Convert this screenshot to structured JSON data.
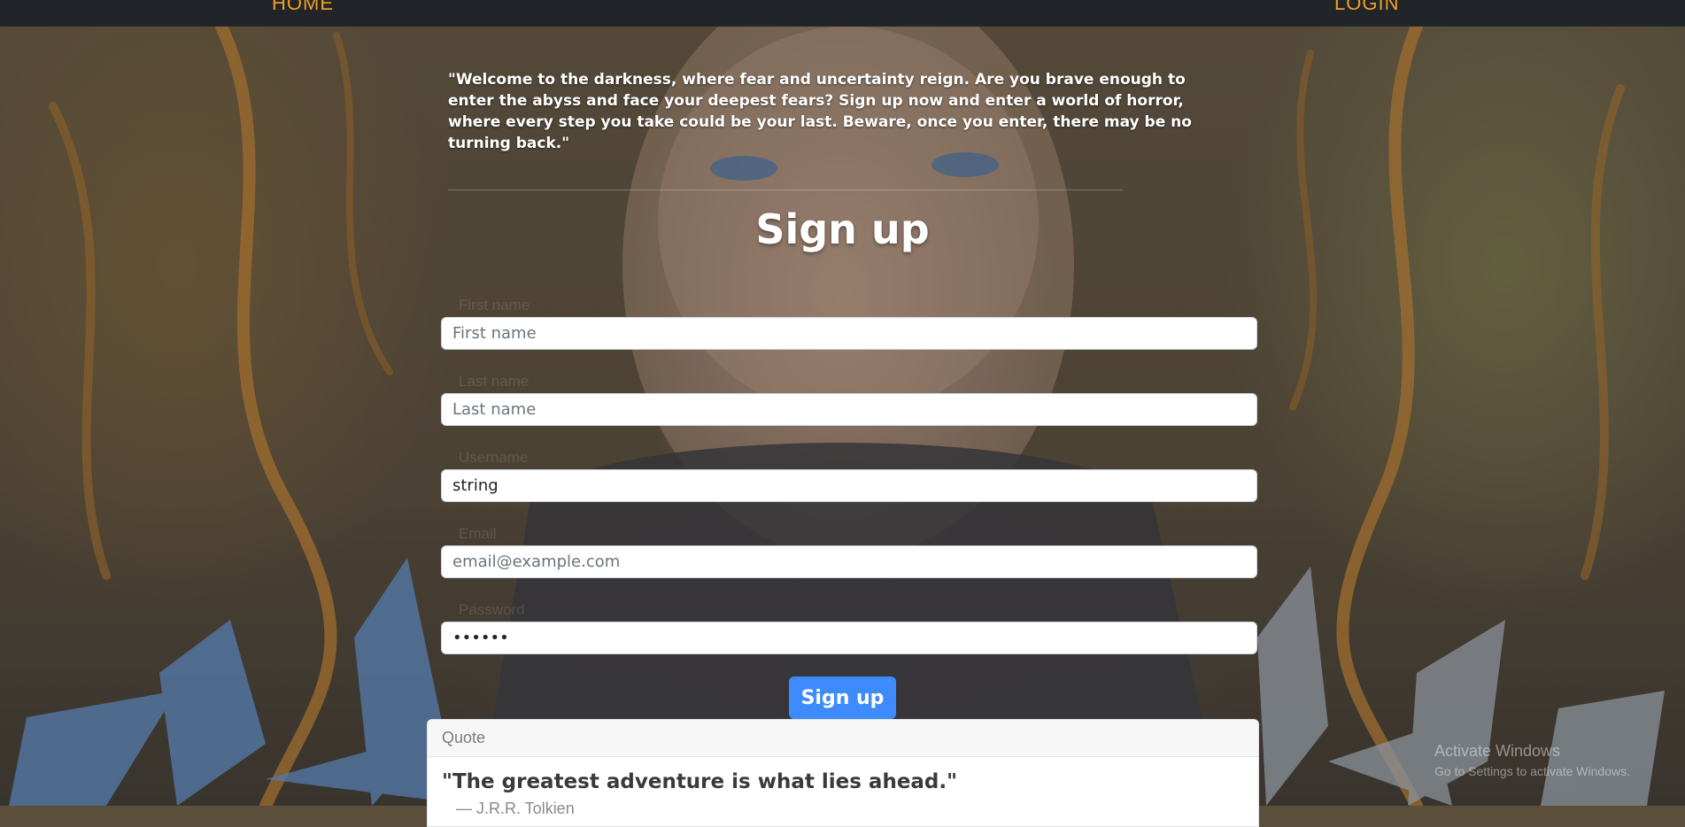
{
  "nav": {
    "home_label": "HOME",
    "login_label": "LOGIN"
  },
  "intro": {
    "text": "\"Welcome to the darkness, where fear and uncertainty reign. Are you brave enough to enter the abyss and face your deepest fears? Sign up now and enter a world of horror, where every step you take could be your last. Beware, once you enter, there may be no turning back.\""
  },
  "form": {
    "title": "Sign up",
    "first_name": {
      "label": "First name",
      "placeholder": "First name",
      "value": ""
    },
    "last_name": {
      "label": "Last name",
      "placeholder": "Last name",
      "value": ""
    },
    "username": {
      "label": "Username",
      "value": "string"
    },
    "email": {
      "label": "Email",
      "placeholder": "email@example.com",
      "value": ""
    },
    "password": {
      "label": "Password",
      "value": "string"
    },
    "submit_label": "Sign up"
  },
  "quote_card": {
    "header": "Quote",
    "text": "\"The greatest adventure is what lies ahead.\"",
    "author": "— J.R.R. Tolkien"
  },
  "watermark": {
    "title": "Activate Windows",
    "subtitle": "Go to Settings to activate Windows."
  },
  "colors": {
    "navbar_bg": "#212529",
    "nav_link": "#f0a020",
    "primary_button": "#3d8bfd"
  }
}
